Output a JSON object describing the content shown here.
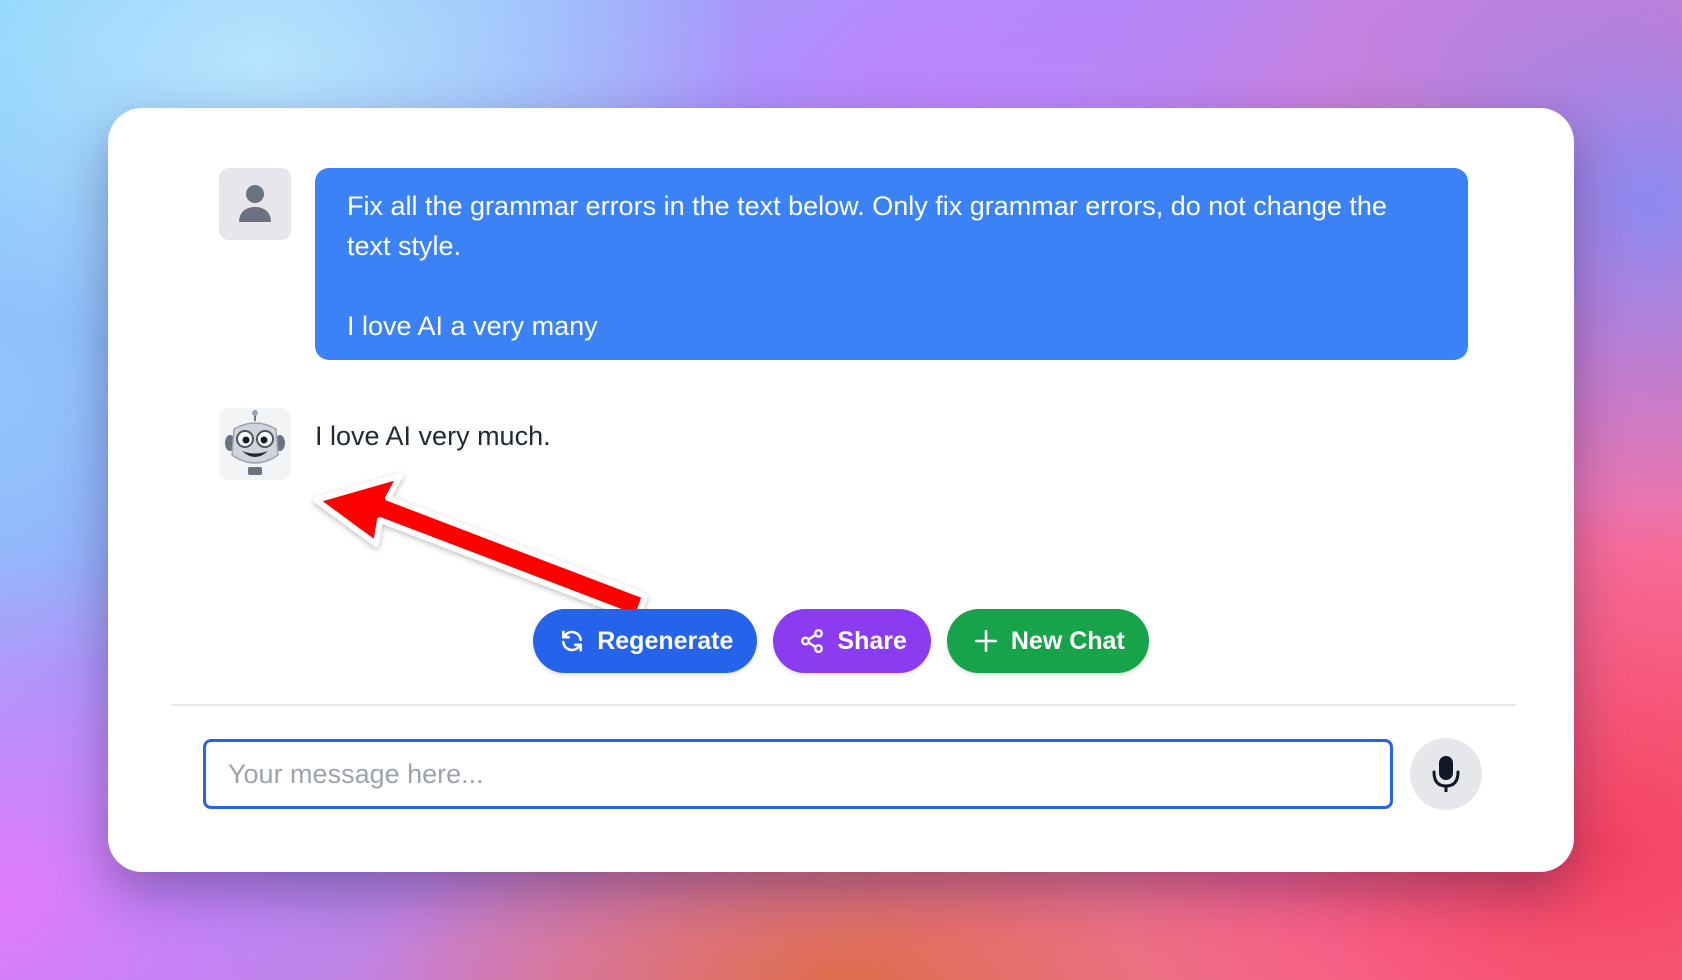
{
  "conversation": {
    "user_message": {
      "avatar_icon": "user-icon",
      "line1": "Fix all the grammar errors in the text below. Only fix grammar errors, do not change the text style.",
      "line2": "I love AI a very many"
    },
    "bot_message": {
      "avatar_icon": "robot-icon",
      "text": "I love AI very much."
    }
  },
  "annotation": {
    "arrow_color": "#ff0000"
  },
  "actions": {
    "regenerate_label": "Regenerate",
    "share_label": "Share",
    "new_chat_label": "New Chat"
  },
  "composer": {
    "placeholder": "Your message here...",
    "value": "",
    "mic_icon": "microphone-icon"
  },
  "colors": {
    "user_bubble": "#3b82f6",
    "regenerate": "#2563eb",
    "share": "#8b3cf0",
    "new_chat": "#16a34a"
  }
}
